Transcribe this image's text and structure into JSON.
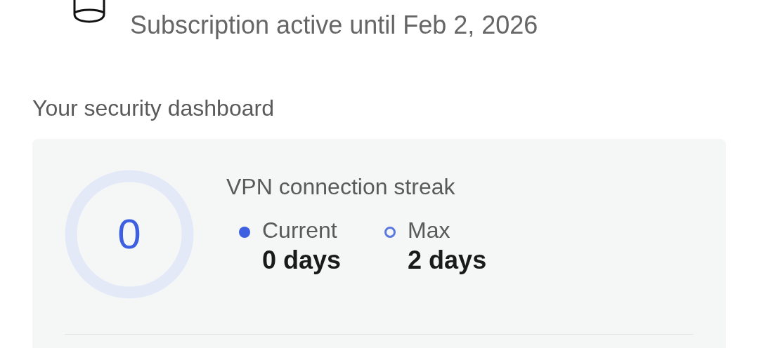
{
  "account": {
    "subscription": "Subscription active until Feb 2, 2026"
  },
  "dashboard": {
    "title": "Your security dashboard",
    "streak": {
      "ring_value": "0",
      "title": "VPN connection streak",
      "legend": [
        {
          "kind": "current",
          "label": "Current",
          "value": "0 days"
        },
        {
          "kind": "max",
          "label": "Max",
          "value": "2 days"
        }
      ]
    }
  }
}
